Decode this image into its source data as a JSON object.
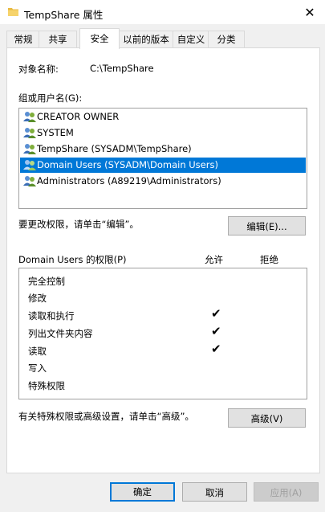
{
  "window": {
    "title": "TempShare 属性",
    "close_glyph": "✕",
    "folder_icon": "folder-icon",
    "close_icon": "close-icon"
  },
  "tabs": [
    {
      "label": "常规"
    },
    {
      "label": "共享"
    },
    {
      "label": "安全",
      "active": true
    },
    {
      "label": "以前的版本"
    },
    {
      "label": "自定义"
    },
    {
      "label": "分类"
    }
  ],
  "object": {
    "label": "对象名称:",
    "value": "C:\\TempShare"
  },
  "groups": {
    "label": "组或用户名(G):",
    "items": [
      {
        "name": "CREATOR OWNER"
      },
      {
        "name": "SYSTEM"
      },
      {
        "name": "TempShare (SYSADM\\TempShare)"
      },
      {
        "name": "Domain Users (SYSADM\\Domain Users)",
        "selected": true
      },
      {
        "name": "Administrators (A89219\\Administrators)"
      }
    ],
    "selected_bg": "#0078d7"
  },
  "edit": {
    "hint": "要更改权限，请单击“编辑”。",
    "button_label": "编辑(E)..."
  },
  "permissions": {
    "label": "Domain Users 的权限(P)",
    "allow_label": "允许",
    "deny_label": "拒绝",
    "check_glyph": "✔",
    "rows": [
      {
        "name": "完全控制",
        "allow": false,
        "deny": false
      },
      {
        "name": "修改",
        "allow": false,
        "deny": false
      },
      {
        "name": "读取和执行",
        "allow": true,
        "deny": false
      },
      {
        "name": "列出文件夹内容",
        "allow": true,
        "deny": false
      },
      {
        "name": "读取",
        "allow": true,
        "deny": false
      },
      {
        "name": "写入",
        "allow": false,
        "deny": false
      },
      {
        "name": "特殊权限",
        "allow": false,
        "deny": false
      }
    ]
  },
  "advanced": {
    "hint": "有关特殊权限或高级设置，请单击“高级”。",
    "button_label": "高级(V)"
  },
  "footer": {
    "ok_label": "确定",
    "cancel_label": "取消",
    "apply_label": "应用(A)"
  }
}
